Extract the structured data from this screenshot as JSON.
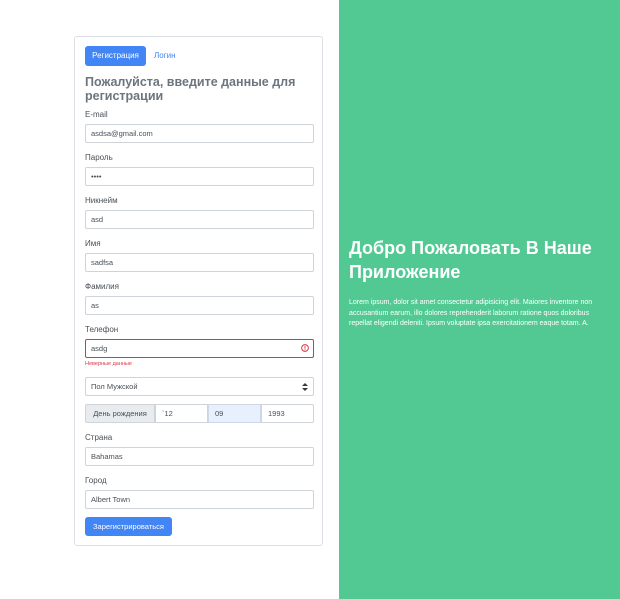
{
  "tabs": {
    "register": "Регистрация",
    "login": "Логин"
  },
  "form": {
    "heading": "Пожалуйста, введите данные для регистрации",
    "email": {
      "label": "E-mail",
      "value": "asdsa@gmail.com"
    },
    "password": {
      "label": "Пароль",
      "value": "••••"
    },
    "nickname": {
      "label": "Никнейм",
      "value": "asd"
    },
    "first_name": {
      "label": "Имя",
      "value": "sadfsa"
    },
    "last_name": {
      "label": "Фамилия",
      "value": "as"
    },
    "phone": {
      "label": "Телефон",
      "value": "asdg",
      "error": "Неверные данные"
    },
    "gender": {
      "value": "Пол Мужской"
    },
    "birthday": {
      "label": "День рождения",
      "day": "`12",
      "month": "09",
      "year": "1993"
    },
    "country": {
      "label": "Страна",
      "value": "Bahamas"
    },
    "city": {
      "label": "Город",
      "value": "Albert Town"
    },
    "submit": "Зарегистрироваться"
  },
  "welcome": {
    "title": "Добро Пожаловать В Наше Приложение",
    "text": "Lorem ipsum, dolor sit amet consectetur adipisicing elit. Maiores inventore non accusantium earum, illo dolores reprehenderit laborum ratione quos doloribus repellat eligendi deleniti. Ipsum voluptate ipsa exercitationem eaque totam. A."
  },
  "colors": {
    "accent": "#4285f4",
    "panel": "#52c993",
    "error": "#dc3545"
  }
}
